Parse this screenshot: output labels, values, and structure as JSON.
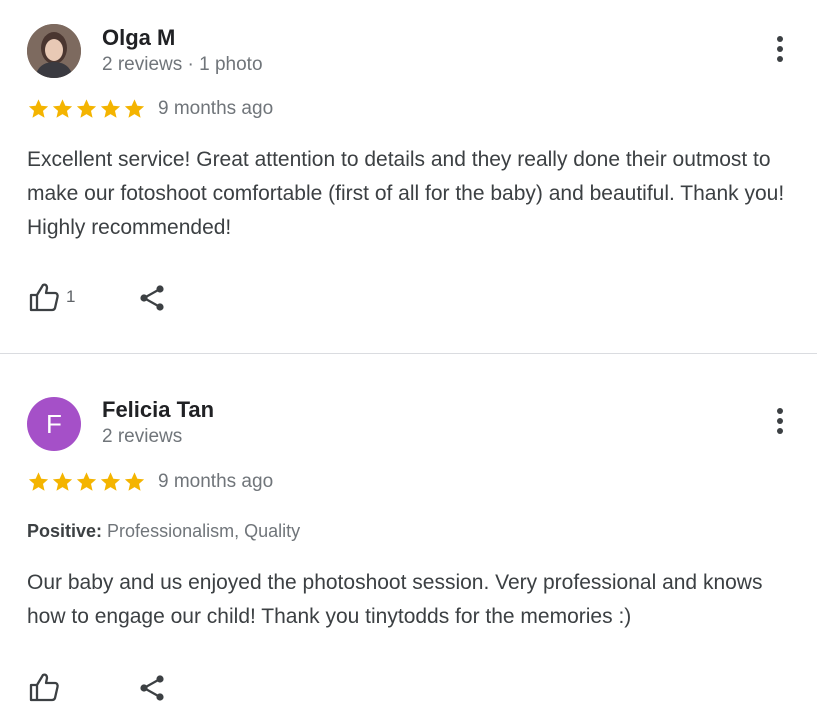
{
  "reviews": [
    {
      "author": "Olga M",
      "meta": "2 reviews · 1 photo",
      "avatar_type": "photo",
      "avatar_letter": "",
      "rating": 5,
      "time": "9 months ago",
      "positive_label": "",
      "positive_values": "",
      "text": "Excellent service! Great attention to details and they really done their outmost to make our fotoshoot comfortable (first of all for the baby) and beautiful. Thank you! Highly recommended!",
      "likes": "1",
      "icons": {
        "like": "thumbs-up-icon",
        "share": "share-icon",
        "more": "more-vert-icon"
      }
    },
    {
      "author": "Felicia Tan",
      "meta": "2 reviews",
      "avatar_type": "letter",
      "avatar_letter": "F",
      "rating": 5,
      "time": "9 months ago",
      "positive_label": "Positive:",
      "positive_values": "Professionalism, Quality",
      "text": "Our baby and us enjoyed the photoshoot session. Very professional and knows how to engage our child! Thank you tinytodds for the memories :)",
      "likes": "",
      "icons": {
        "like": "thumbs-up-icon",
        "share": "share-icon",
        "more": "more-vert-icon"
      }
    }
  ],
  "colors": {
    "star": "#f4b400",
    "avatar_letter_bg": "#a550c8",
    "divider": "#dadce0",
    "secondary_text": "#70757a",
    "icon": "#3c4043"
  }
}
